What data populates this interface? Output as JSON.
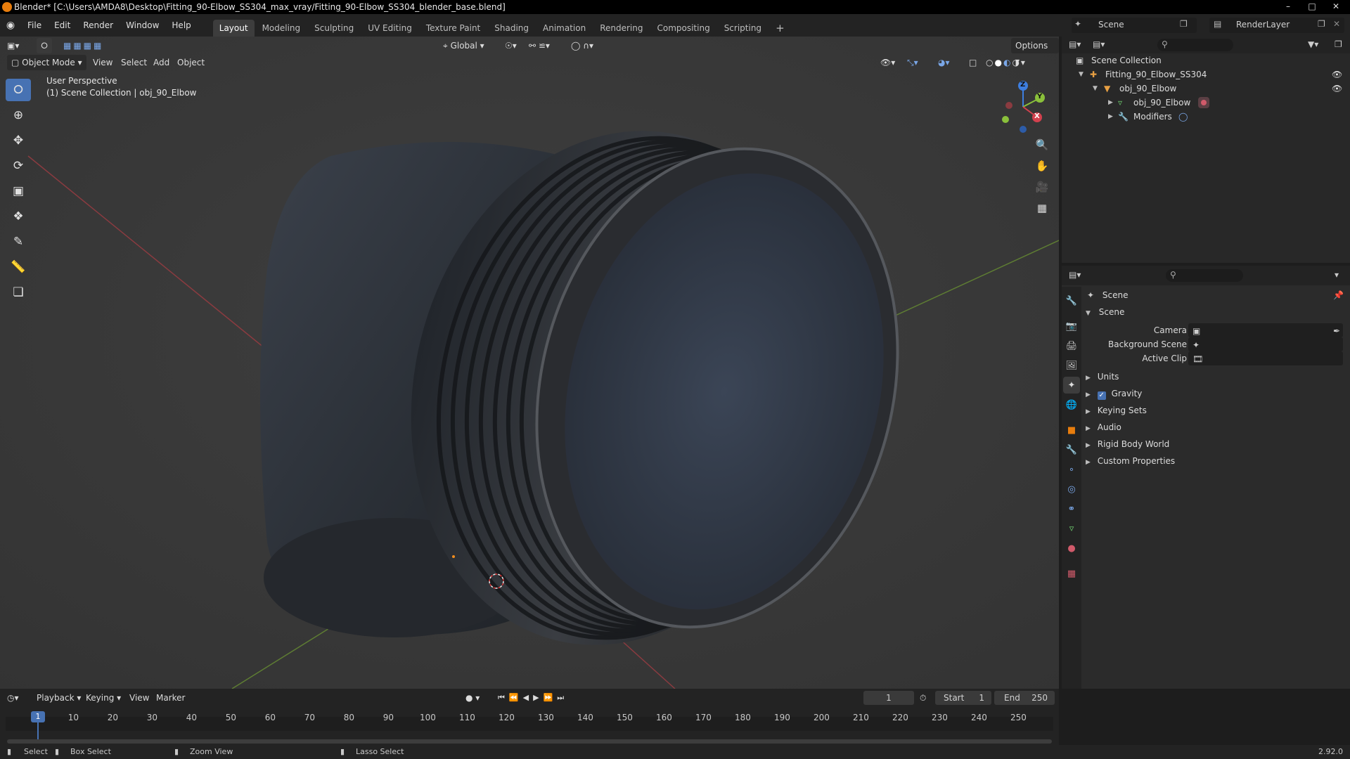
{
  "window": {
    "title": "Blender* [C:\\Users\\AMDA8\\Desktop\\Fitting_90-Elbow_SS304_max_vray/Fitting_90-Elbow_SS304_blender_base.blend]",
    "minimize": "–",
    "maximize": "□",
    "close": "✕"
  },
  "menu": [
    "File",
    "Edit",
    "Render",
    "Window",
    "Help"
  ],
  "workspaces": [
    "Layout",
    "Modeling",
    "Sculpting",
    "UV Editing",
    "Texture Paint",
    "Shading",
    "Animation",
    "Rendering",
    "Compositing",
    "Scripting"
  ],
  "active_workspace": "Layout",
  "scene_selector": "Scene",
  "view_layer_selector": "RenderLayer",
  "viewport": {
    "mode": "Object Mode",
    "menus": [
      "View",
      "Select",
      "Add",
      "Object"
    ],
    "transform_orientation": "Global",
    "options_label": "Options",
    "overlay_line1": "User Perspective",
    "overlay_line2": "(1) Scene Collection | obj_90_Elbow",
    "gizmo_axes": {
      "x": "X",
      "y": "Y",
      "z": "Z"
    }
  },
  "outliner": {
    "root": "Scene Collection",
    "items": [
      {
        "label": "Fitting_90_Elbow_SS304"
      },
      {
        "label": "obj_90_Elbow"
      },
      {
        "label": "obj_90_Elbow"
      },
      {
        "label": "Modifiers"
      }
    ]
  },
  "properties": {
    "context": "Scene",
    "panel_title": "Scene",
    "fields": [
      {
        "label": "Camera",
        "value": ""
      },
      {
        "label": "Background Scene",
        "value": ""
      },
      {
        "label": "Active Clip",
        "value": ""
      }
    ],
    "sections": [
      "Units",
      "Gravity",
      "Keying Sets",
      "Audio",
      "Rigid Body World",
      "Custom Properties"
    ],
    "gravity_checked": true
  },
  "timeline": {
    "menus": [
      "Playback",
      "Keying",
      "View",
      "Marker"
    ],
    "current_frame": "1",
    "start_label": "Start",
    "start": "1",
    "end_label": "End",
    "end": "250",
    "ticks": [
      "10",
      "20",
      "30",
      "40",
      "50",
      "60",
      "70",
      "80",
      "90",
      "100",
      "110",
      "120",
      "130",
      "140",
      "150",
      "160",
      "170",
      "180",
      "190",
      "200",
      "210",
      "220",
      "230",
      "240",
      "250"
    ],
    "cursor_frame": "1"
  },
  "statusbar": {
    "select": "Select",
    "box_select": "Box Select",
    "zoom_view": "Zoom View",
    "lasso_select": "Lasso Select",
    "version": "2.92.0"
  },
  "colors": {
    "accent": "#4772b3",
    "orange": "#e87d0d",
    "axis_x": "#d3414e",
    "axis_y": "#8ac03b",
    "axis_z": "#3d7ee0"
  }
}
